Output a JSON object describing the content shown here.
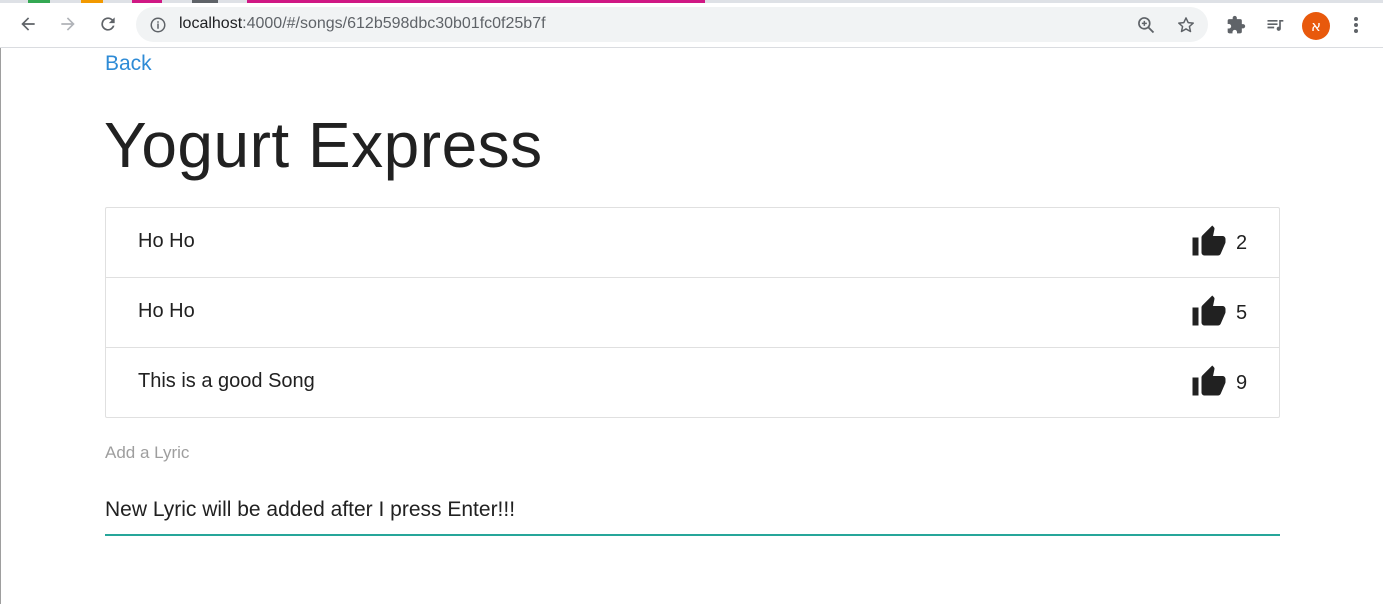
{
  "browser": {
    "url_host": "localhost",
    "url_rest": ":4000/#/songs/612b598dbc30b01fc0f25b7f",
    "profile_initial": "א",
    "tab_accent_colors": [
      "#34a853",
      "#f29900",
      "#d01884",
      "#5f6368",
      "#d01884"
    ]
  },
  "page": {
    "back_label": "Back",
    "title": "Yogurt Express",
    "lyrics": [
      {
        "text": "Ho Ho",
        "likes": "2"
      },
      {
        "text": "Ho Ho",
        "likes": "5"
      },
      {
        "text": "This is a good Song",
        "likes": "9"
      }
    ],
    "input_label": "Add a Lyric",
    "input_value": "New Lyric will be added after I press Enter!!!"
  },
  "colors": {
    "link": "#2e8bd6",
    "input_underline": "#26a69a",
    "avatar": "#e8590c"
  }
}
